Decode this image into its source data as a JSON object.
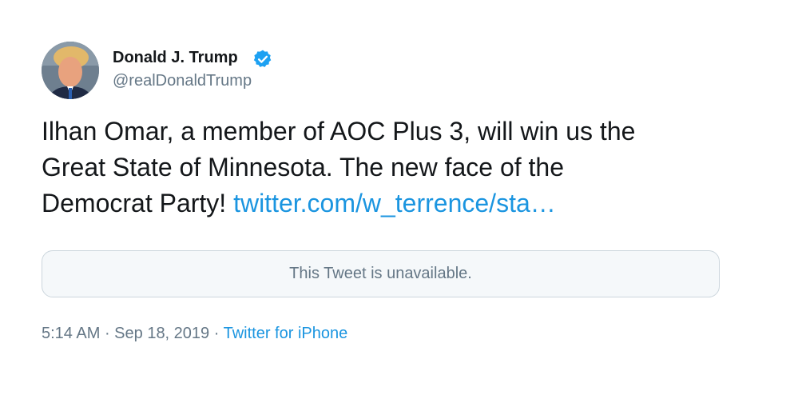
{
  "author": {
    "display_name": "Donald J. Trump",
    "handle": "@realDonaldTrump",
    "verified": true,
    "avatar_icon": "profile-photo"
  },
  "tweet": {
    "line1": "Ilhan Omar, a member of AOC Plus 3, will win us the",
    "line2": "Great State of Minnesota. The new face of the",
    "line3_text": "Democrat Party! ",
    "link_text": "twitter.com/w_terrence/sta…"
  },
  "quoted_tweet": {
    "status": "This Tweet is unavailable."
  },
  "meta": {
    "time": "5:14 AM",
    "separator": " · ",
    "date": "Sep 18, 2019",
    "source": "Twitter for iPhone"
  },
  "colors": {
    "link": "#1b95e0",
    "verified_badge": "#1da1f2",
    "secondary_text": "#657786",
    "card_background": "#f5f8fa",
    "card_border": "#ccd6dd"
  }
}
